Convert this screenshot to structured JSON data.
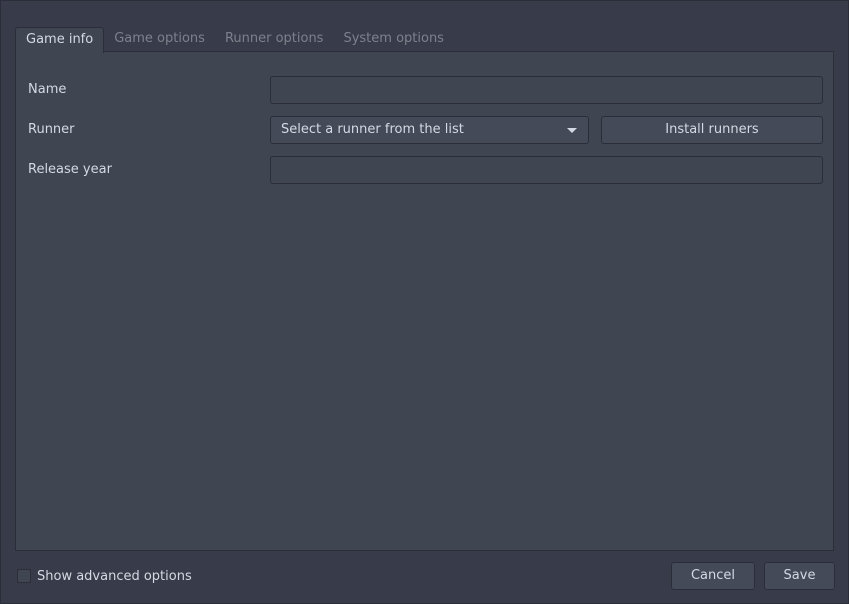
{
  "tabs": [
    {
      "label": "Game info",
      "active": true
    },
    {
      "label": "Game options",
      "active": false
    },
    {
      "label": "Runner options",
      "active": false
    },
    {
      "label": "System options",
      "active": false
    }
  ],
  "form": {
    "name_label": "Name",
    "name_value": "",
    "runner_label": "Runner",
    "runner_selected": "Select a runner from the list",
    "install_runners_label": "Install runners",
    "release_year_label": "Release year",
    "release_year_value": ""
  },
  "footer": {
    "advanced_label": "Show advanced options",
    "advanced_checked": false,
    "cancel_label": "Cancel",
    "save_label": "Save"
  },
  "colors": {
    "background": "#383c4a",
    "panel": "#404552",
    "border": "#2b2e39",
    "text": "#d3dae3",
    "inactive_tab_text": "#7c818c",
    "button": "#444a58"
  },
  "icons": {
    "combo_arrow": "chevron-down-icon"
  }
}
